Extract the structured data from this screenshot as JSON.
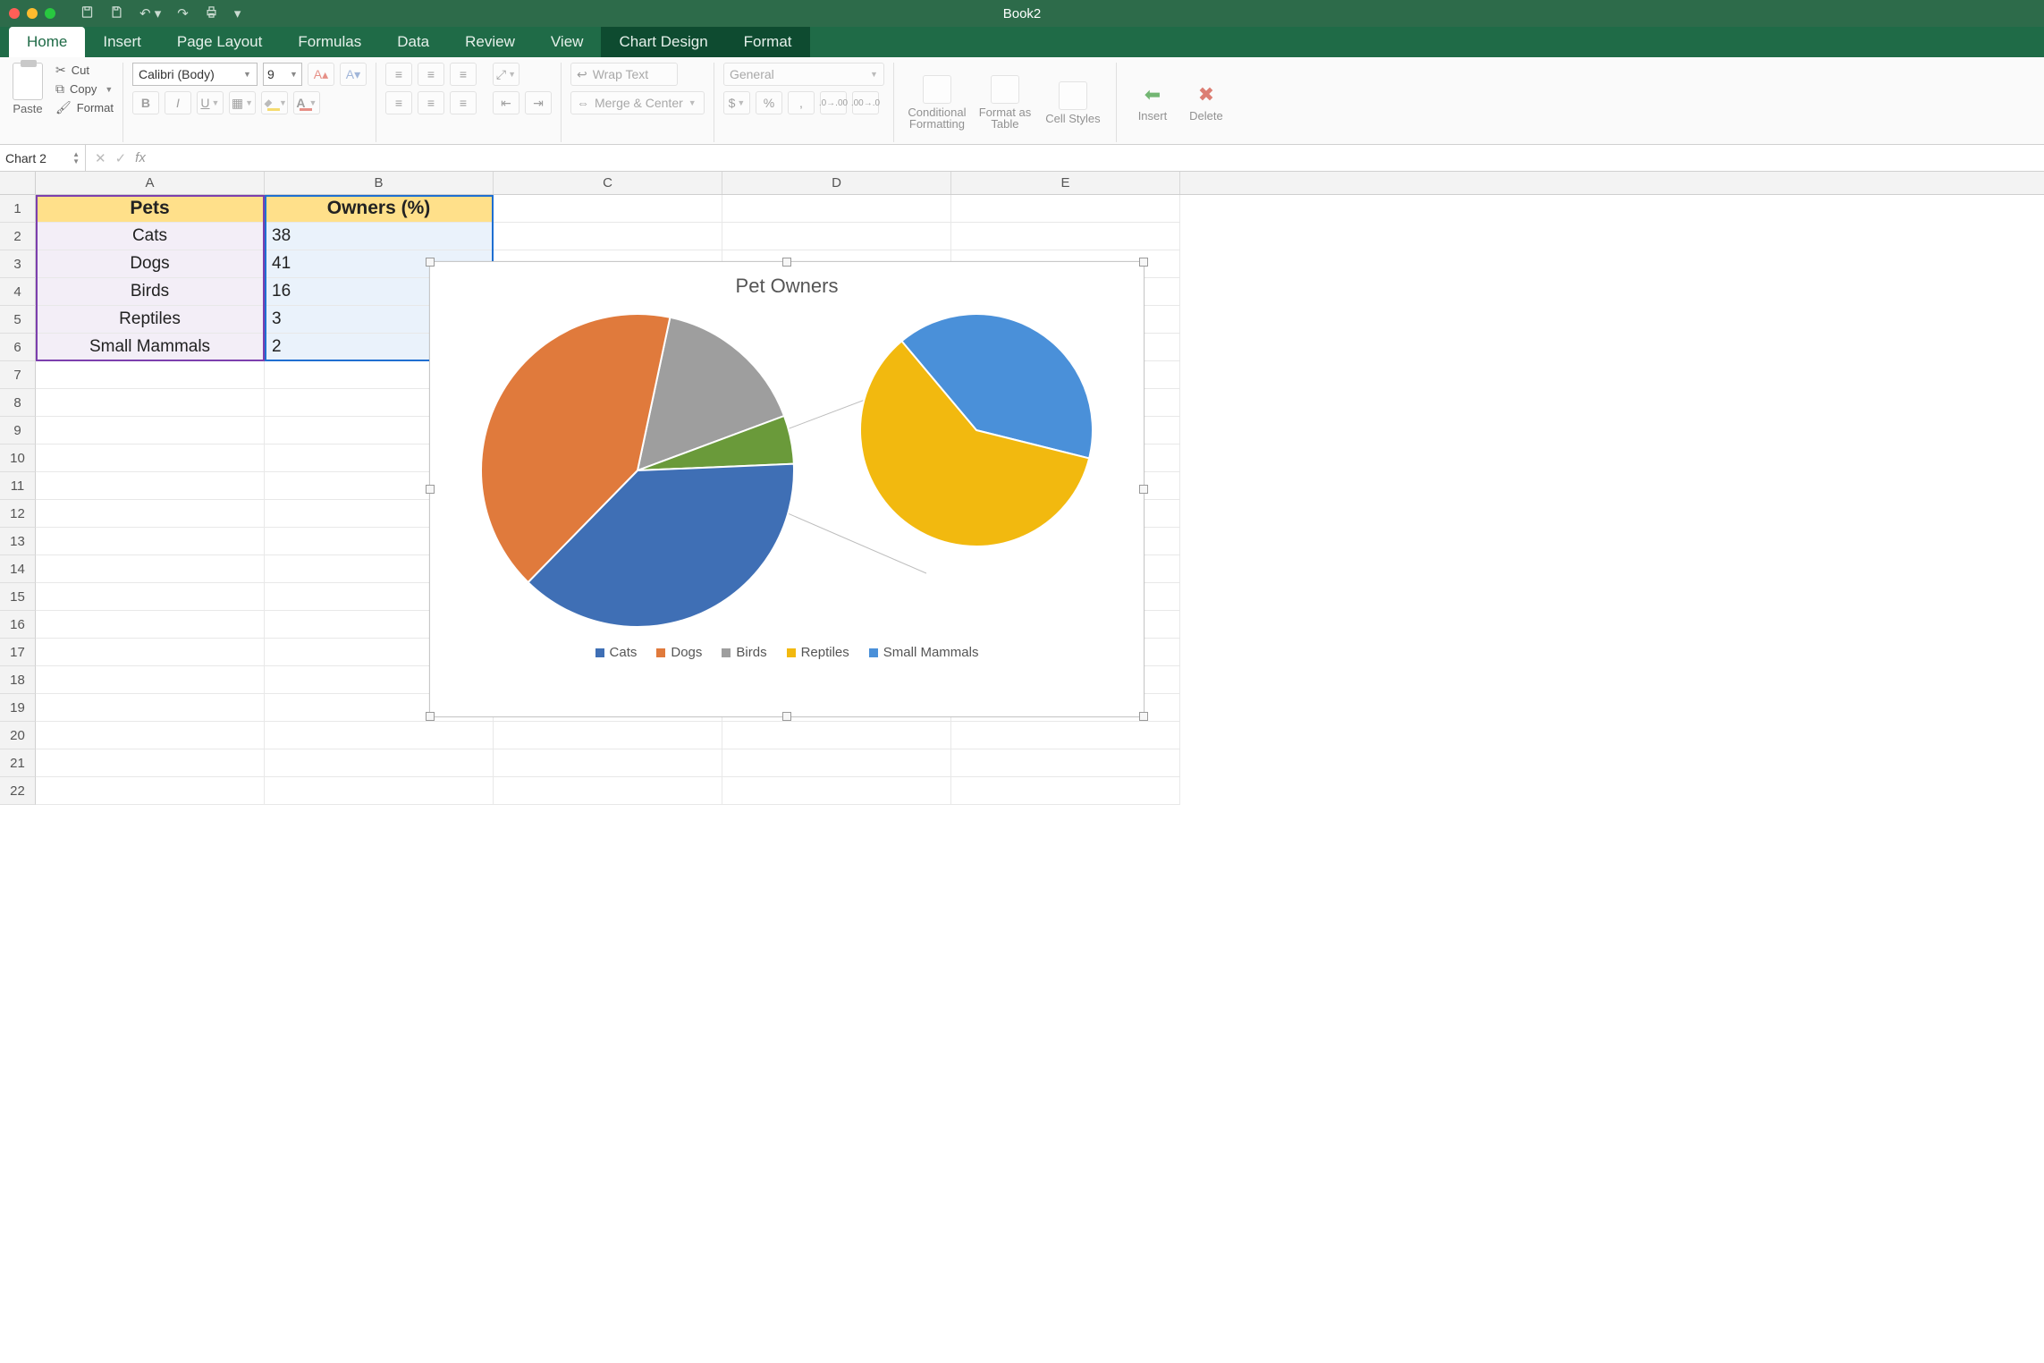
{
  "titlebar": {
    "book_title": "Book2"
  },
  "tabs": {
    "home": "Home",
    "insert": "Insert",
    "page_layout": "Page Layout",
    "formulas": "Formulas",
    "data": "Data",
    "review": "Review",
    "view": "View",
    "chart_design": "Chart Design",
    "format": "Format"
  },
  "ribbon": {
    "paste": "Paste",
    "cut": "Cut",
    "copy": "Copy",
    "format_painter": "Format",
    "font_name": "Calibri (Body)",
    "font_size": "9",
    "wrap_text": "Wrap Text",
    "merge_center": "Merge & Center",
    "number_format": "General",
    "cond_fmt": "Conditional Formatting",
    "fmt_table": "Format as Table",
    "cell_styles": "Cell Styles",
    "insert": "Insert",
    "delete": "Delete"
  },
  "fbar": {
    "name_box": "Chart 2",
    "formula": ""
  },
  "columns": [
    "A",
    "B",
    "C",
    "D",
    "E"
  ],
  "rows": [
    "1",
    "2",
    "3",
    "4",
    "5",
    "6",
    "7",
    "8",
    "9",
    "10",
    "11",
    "12",
    "13",
    "14",
    "15",
    "16",
    "17",
    "18",
    "19",
    "20",
    "21",
    "22"
  ],
  "table": {
    "headers": {
      "A": "Pets",
      "B": "Owners (%)"
    },
    "data": [
      {
        "A": "Cats",
        "B": "38"
      },
      {
        "A": "Dogs",
        "B": "41"
      },
      {
        "A": "Birds",
        "B": "16"
      },
      {
        "A": "Reptiles",
        "B": "3"
      },
      {
        "A": "Small Mammals",
        "B": "2"
      }
    ]
  },
  "chart_data": {
    "type": "pie",
    "title": "Pet Owners",
    "series": [
      {
        "name": "Cats",
        "value": 38,
        "color": "#3f6fb5"
      },
      {
        "name": "Dogs",
        "value": 41,
        "color": "#e07a3c"
      },
      {
        "name": "Birds",
        "value": 16,
        "color": "#9e9e9e"
      },
      {
        "name": "Reptiles",
        "value": 3,
        "color": "#f2b90f"
      },
      {
        "name": "Small Mammals",
        "value": 2,
        "color": "#4a90d9"
      }
    ],
    "secondary_pie_split": {
      "method": "position",
      "last_n": 2,
      "remainder_color": "#6a9a3a",
      "note": "Smallest two slices (Reptiles, Small Mammals) shown as green 'Other' slice on main pie and detailed on secondary pie."
    },
    "legend_position": "bottom"
  }
}
